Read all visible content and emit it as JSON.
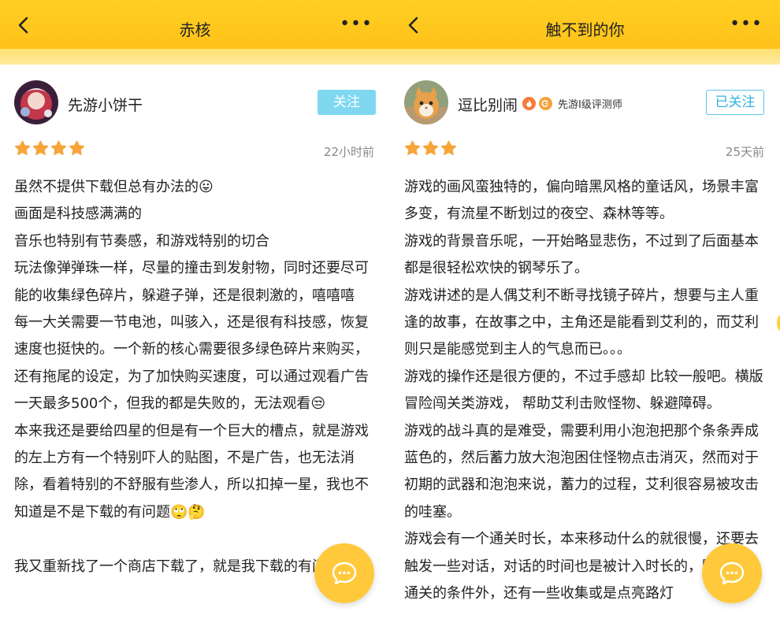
{
  "screens": [
    {
      "title": "赤核",
      "user": {
        "name": "先游小饼干"
      },
      "follow_label": "关注",
      "rating": 4,
      "time": "22小时前",
      "paragraphs": [
        "虽然不提供下载但总有办法的😛",
        "画面是科技感满满的",
        "音乐也特别有节奏感，和游戏特别的切合",
        "玩法像弹弹珠一样，尽量的撞击到发射物，同时还要尽可能的收集绿色碎片，躲避子弹，还是很刺激的，嘻嘻嘻",
        "每一大关需要一节电池，叫骇入，还是很有科技感，恢复速度也挺快的。一个新的核心需要很多绿色碎片来购买，还有拖尾的设定，为了加快购买速度，可以通过观看广告一天最多500个，但我的都是失败的，无法观看😒",
        "本来我还是要给四星的但是有一个巨大的槽点，就是游戏的左上方有一个特别吓人的贴图，不是广告，也无法消除，看着特别的不舒服有些渗人，所以扣掉一星，我也不知道是不是下载的有问题🙄🤔",
        "",
        "我又重新找了一个商店下载了，就是我下载的有问题"
      ]
    },
    {
      "title": "触不到的你",
      "user": {
        "name": "逗比别闹",
        "badge_label": "先游I级评测师"
      },
      "follow_label": "已关注",
      "rating": 3,
      "time": "25天前",
      "paragraphs": [
        "游戏的画风蛮独特的，偏向暗黑风格的童话风，场景丰富多变，有流星不断划过的夜空、森林等等。",
        "游戏的背景音乐呢，一开始略显悲伤，不过到了后面基本都是很轻松欢快的钢琴乐了。",
        "游戏讲述的是人偶艾利不断寻找镜子碎片，想要与主人重逢的故事，在故事之中，主角还是能看到艾利的，而艾利则只是能感觉到主人的气息而已。。。",
        "游戏的操作还是很方便的，不过手感却 比较一般吧。横版冒险闯关类游戏， 帮助艾利击败怪物、躲避障碍。",
        "游戏的战斗真的是难受，需要利用小泡泡把那个条条弄成蓝色的，然后蓄力放大泡泡困住怪物点击消灭，然而对于初期的武器和泡泡来说，蓄力的过程，艾利很容易被攻击的哇塞。",
        "游戏会有一个通关时长，本来移动什么的就很慢，还要去触发一些对话，对话的时间也是被计入时长的，除了三星通关的条件外，还有一些收集或是点亮路灯"
      ]
    }
  ],
  "colors": {
    "header": "#ffc21a",
    "star": "#f7a43a",
    "follow_solid": "#7fd8f0",
    "follow_outline": "#34b3dd",
    "fab": "#ffc93b"
  },
  "icons": {
    "back": "chevron-left-icon",
    "more": "more-horizontal-icon",
    "star": "star-icon",
    "chat": "chat-bubble-icon"
  }
}
